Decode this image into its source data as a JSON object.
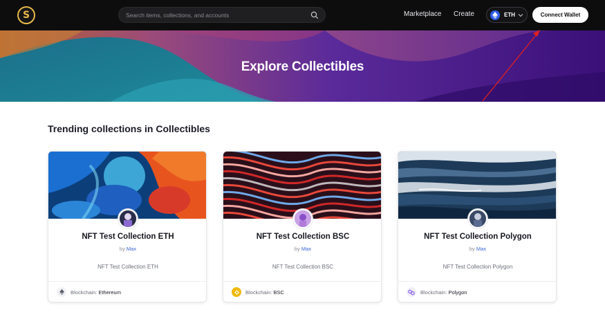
{
  "header": {
    "logo": "S",
    "search_placeholder": "Search items, collections, and accounts",
    "nav": [
      "Marketplace",
      "Create"
    ],
    "chain": "ETH",
    "connect_wallet": "Connect Wallet"
  },
  "hero": {
    "title": "Explore Collectibles"
  },
  "section": {
    "title": "Trending collections in Collectibles"
  },
  "cards": [
    {
      "title": "NFT Test Collection ETH",
      "by": "by",
      "owner": "Max",
      "description": "NFT Test Collection ETH",
      "chain_key": "Blockchain:",
      "chain_value": "Ethereum",
      "chain_icon": "ethereum-icon"
    },
    {
      "title": "NFT Test Collection BSC",
      "by": "by",
      "owner": "Max",
      "description": "NFT Test Collection BSC",
      "chain_key": "Blockchain:",
      "chain_value": "BSC",
      "chain_icon": "bsc-icon"
    },
    {
      "title": "NFT Test Collection Polygon",
      "by": "by",
      "owner": "Max",
      "description": "NFT Test Collection Polygon",
      "chain_key": "Blockchain:",
      "chain_value": "Polygon",
      "chain_icon": "polygon-icon"
    }
  ],
  "colors": {
    "header_bg": "#0d0d0e",
    "accent_blue": "#3a63d8",
    "hero_purple": "#4a1a8c",
    "bsc_yellow": "#f0b90b",
    "annotation_red": "#e02020"
  }
}
